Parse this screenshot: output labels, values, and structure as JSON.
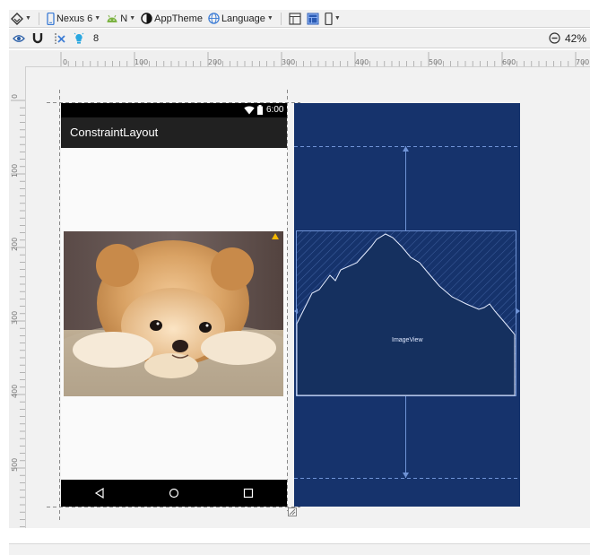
{
  "toolbar": {
    "device_label": "Nexus 6",
    "api_label": "N",
    "theme_label": "AppTheme",
    "language_label": "Language",
    "margin_value": "8",
    "zoom_label": "42%"
  },
  "rulers": {
    "horizontal_ticks": [
      "0",
      "100",
      "200",
      "300",
      "400",
      "500",
      "600",
      "700"
    ],
    "vertical_ticks": [
      "0",
      "100",
      "200",
      "300",
      "400",
      "500"
    ]
  },
  "device": {
    "status_time": "6:00",
    "app_title": "ConstraintLayout"
  },
  "blueprint": {
    "imageview_label": "ImageView"
  },
  "colors": {
    "blueprint_bg": "#16336c",
    "blueprint_line": "#6f93d6",
    "appbar": "#212121",
    "warning": "#f5b800"
  }
}
